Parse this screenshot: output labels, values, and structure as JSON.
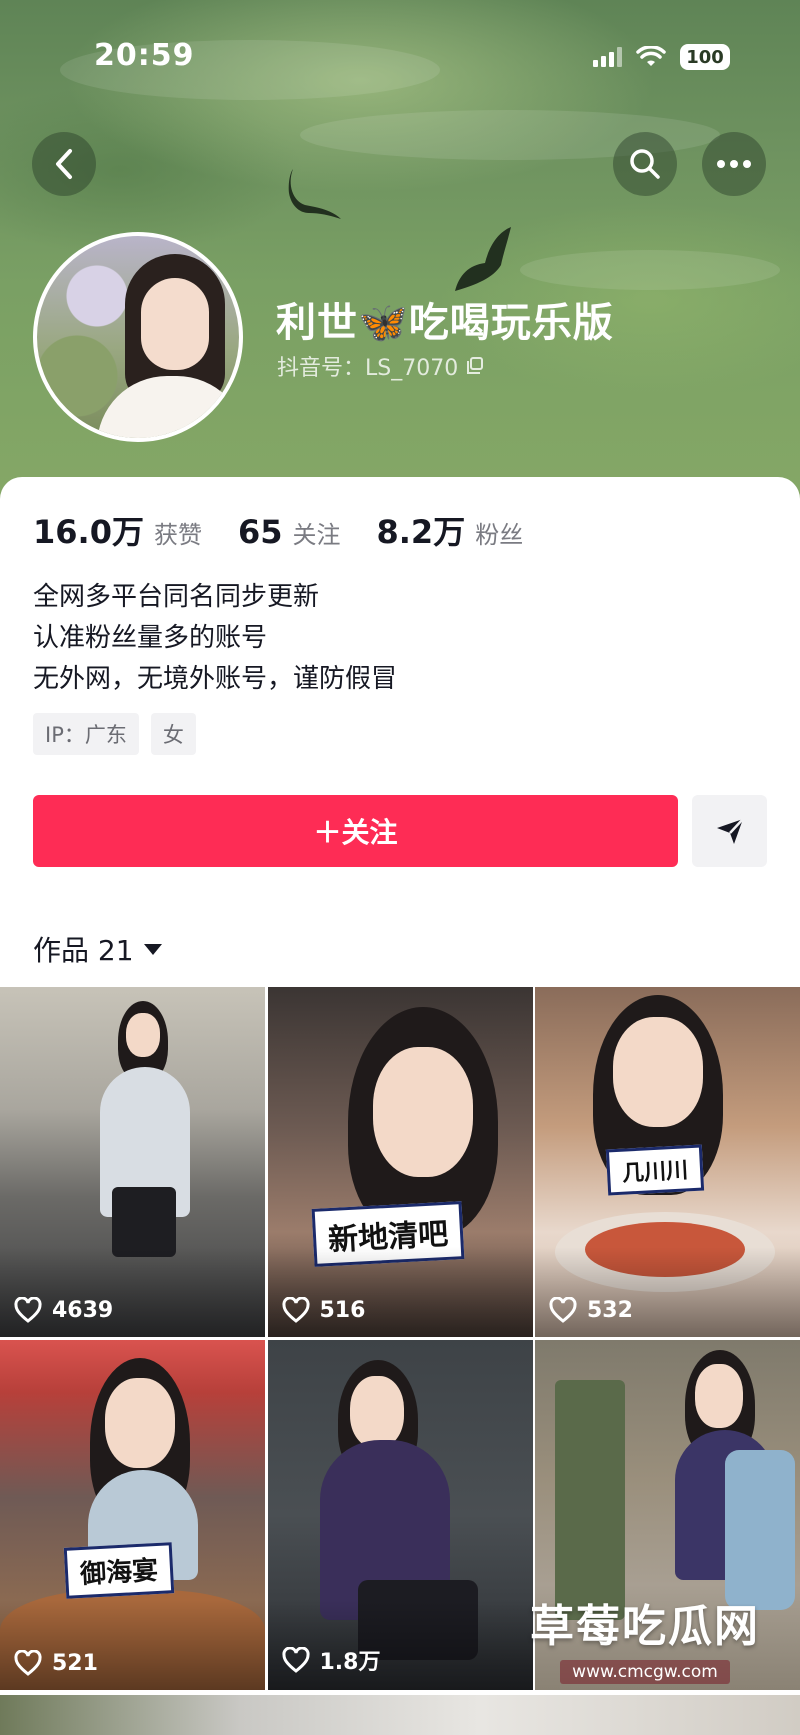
{
  "status_bar": {
    "time": "20:59",
    "battery": "100"
  },
  "header": {
    "nickname": "利世🦋吃喝玩乐版",
    "douyin_id": "抖音号：LS_7070",
    "icons": [
      "back-arrow-icon",
      "search-icon",
      "more-icon",
      "copy-icon"
    ]
  },
  "stats": [
    {
      "value": "16.0万",
      "label": "获赞"
    },
    {
      "value": "65",
      "label": "关注"
    },
    {
      "value": "8.2万",
      "label": "粉丝"
    }
  ],
  "bio": [
    "全网多平台同名同步更新",
    "认准粉丝量多的账号",
    "无外网，无境外账号，谨防假冒"
  ],
  "tags": [
    "IP：广东",
    "女"
  ],
  "actions": {
    "follow_label": "＋关注"
  },
  "works_tab": {
    "label": "作品 21"
  },
  "videos": [
    {
      "likes": "4639",
      "caption": ""
    },
    {
      "likes": "516",
      "caption": "新地清吧"
    },
    {
      "likes": "532",
      "caption": "几川川"
    },
    {
      "likes": "521",
      "caption": "御海宴"
    },
    {
      "likes": "1.8万",
      "caption": ""
    },
    {
      "likes": "",
      "caption": ""
    }
  ],
  "watermark": {
    "title": "草莓吃瓜网",
    "url": "www.cmcgw.com"
  },
  "colors": {
    "follow_button": "#fe2c55",
    "header_green": "#6f9360"
  }
}
